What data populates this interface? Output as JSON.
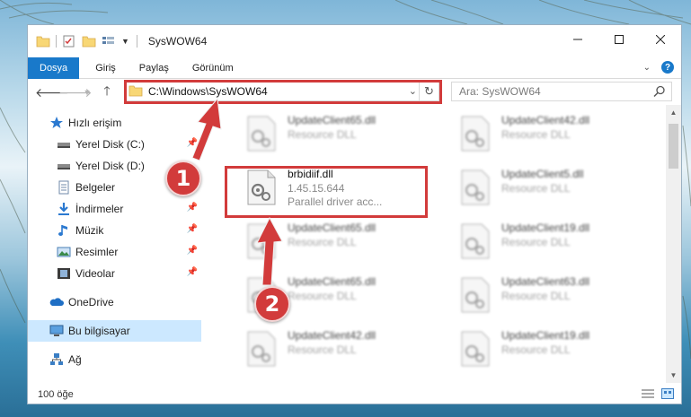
{
  "window": {
    "title": "SysWOW64"
  },
  "ribbon": {
    "tabs": [
      "Dosya",
      "Giriş",
      "Paylaş",
      "Görünüm"
    ]
  },
  "address": {
    "path": "C:\\Windows\\SysWOW64"
  },
  "search": {
    "placeholder": "Ara: SysWOW64"
  },
  "sidebar": {
    "items": [
      {
        "label": "Hızlı erişim",
        "icon": "star-icon"
      },
      {
        "label": "Yerel Disk (C:)",
        "icon": "drive-icon"
      },
      {
        "label": "Yerel Disk (D:)",
        "icon": "drive-icon"
      },
      {
        "label": "Belgeler",
        "icon": "document-icon"
      },
      {
        "label": "İndirmeler",
        "icon": "download-icon"
      },
      {
        "label": "Müzik",
        "icon": "music-icon"
      },
      {
        "label": "Resimler",
        "icon": "pictures-icon"
      },
      {
        "label": "Videolar",
        "icon": "video-icon"
      },
      {
        "label": "OneDrive",
        "icon": "cloud-icon"
      },
      {
        "label": "Bu bilgisayar",
        "icon": "computer-icon"
      },
      {
        "label": "Ağ",
        "icon": "network-icon"
      }
    ]
  },
  "files": [
    {
      "name": "UpdateClient65.dll",
      "sub": "Resource DLL"
    },
    {
      "name": "UpdateClient42.dll",
      "sub": "Resource DLL"
    },
    {
      "name": "brbidiif.dll",
      "sub": "1.45.15.644",
      "sub2": "Parallel driver acc..."
    },
    {
      "name": "UpdateClient5.dll",
      "sub": "Resource DLL"
    },
    {
      "name": "UpdateClient65.dll",
      "sub": "Resource DLL"
    },
    {
      "name": "UpdateClient19.dll",
      "sub": "Resource DLL"
    },
    {
      "name": "UpdateClient65.dll",
      "sub": "Resource DLL"
    },
    {
      "name": "UpdateClient63.dll",
      "sub": "Resource DLL"
    },
    {
      "name": "UpdateClient42.dll",
      "sub": "Resource DLL"
    },
    {
      "name": "UpdateClient19.dll",
      "sub": "Resource DLL"
    }
  ],
  "status": {
    "count": "100 öğe"
  },
  "callouts": [
    "1",
    "2"
  ],
  "colors": {
    "accent": "#1979ca",
    "highlight": "#d23b3b",
    "selection": "#cce8ff"
  }
}
